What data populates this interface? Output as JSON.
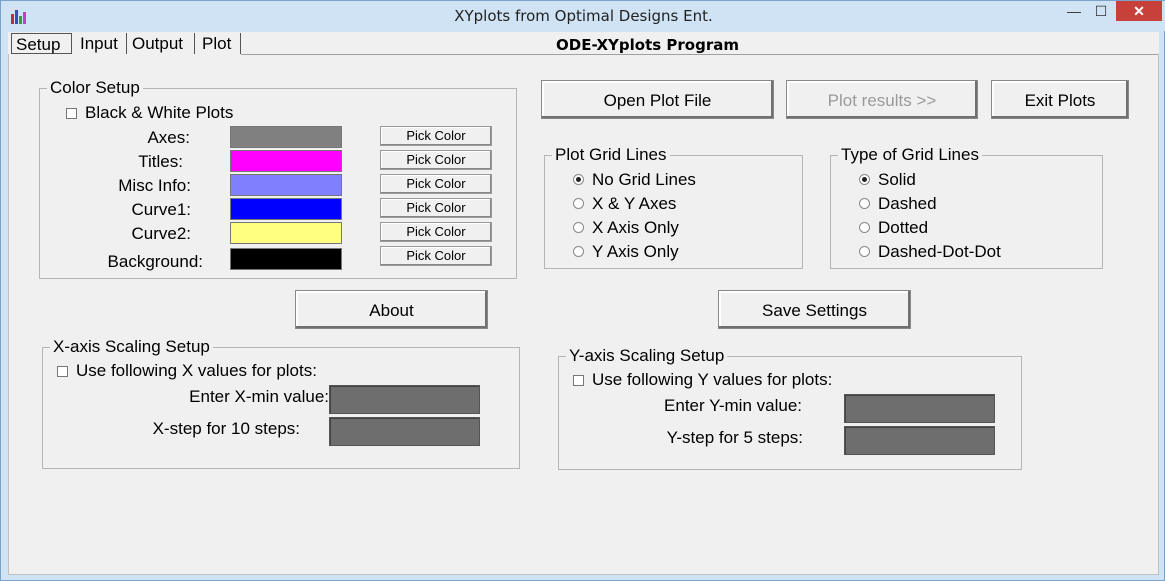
{
  "window": {
    "title": "XYplots from Optimal Designs Ent.",
    "controls": {
      "minimize": "—",
      "maximize": "☐",
      "close": "✕"
    }
  },
  "tabs": [
    {
      "label": "Setup",
      "active": true
    },
    {
      "label": "Input",
      "active": false
    },
    {
      "label": "Output",
      "active": false
    },
    {
      "label": "Plot",
      "active": false
    }
  ],
  "program_title": "ODE-XYplots Program",
  "color_setup": {
    "title": "Color Setup",
    "bw_label": "Black & White Plots",
    "bw_checked": false,
    "pick_label": "Pick Color",
    "rows": [
      {
        "label": "Axes:",
        "color": "#808080"
      },
      {
        "label": "Titles:",
        "color": "#ff00ff"
      },
      {
        "label": "Misc Info:",
        "color": "#8080ff"
      },
      {
        "label": "Curve1:",
        "color": "#0000ff"
      },
      {
        "label": "Curve2:",
        "color": "#ffff80"
      },
      {
        "label": "Background:",
        "color": "#000000"
      }
    ]
  },
  "buttons": {
    "open_plot": "Open Plot File",
    "plot_results": "Plot results >>",
    "exit_plots": "Exit Plots",
    "about": "About",
    "save_settings": "Save Settings"
  },
  "plot_grid_lines": {
    "title": "Plot Grid Lines",
    "options": [
      {
        "label": "No Grid Lines",
        "checked": true
      },
      {
        "label": "X & Y Axes",
        "checked": false
      },
      {
        "label": "X Axis Only",
        "checked": false
      },
      {
        "label": "Y Axis Only",
        "checked": false
      }
    ]
  },
  "type_grid_lines": {
    "title": "Type of Grid Lines",
    "options": [
      {
        "label": "Solid",
        "checked": true
      },
      {
        "label": "Dashed",
        "checked": false
      },
      {
        "label": "Dotted",
        "checked": false
      },
      {
        "label": "Dashed-Dot-Dot",
        "checked": false
      }
    ]
  },
  "x_scaling": {
    "title": "X-axis Scaling Setup",
    "use_label": "Use following X values for plots:",
    "use_checked": false,
    "min_label": "Enter X-min value:",
    "step_label": "X-step for 10 steps:",
    "min_value": "",
    "step_value": ""
  },
  "y_scaling": {
    "title": "Y-axis Scaling Setup",
    "use_label": "Use following Y values for plots:",
    "use_checked": false,
    "min_label": "Enter Y-min value:",
    "step_label": "Y-step for 5 steps:",
    "min_value": "",
    "step_value": ""
  }
}
